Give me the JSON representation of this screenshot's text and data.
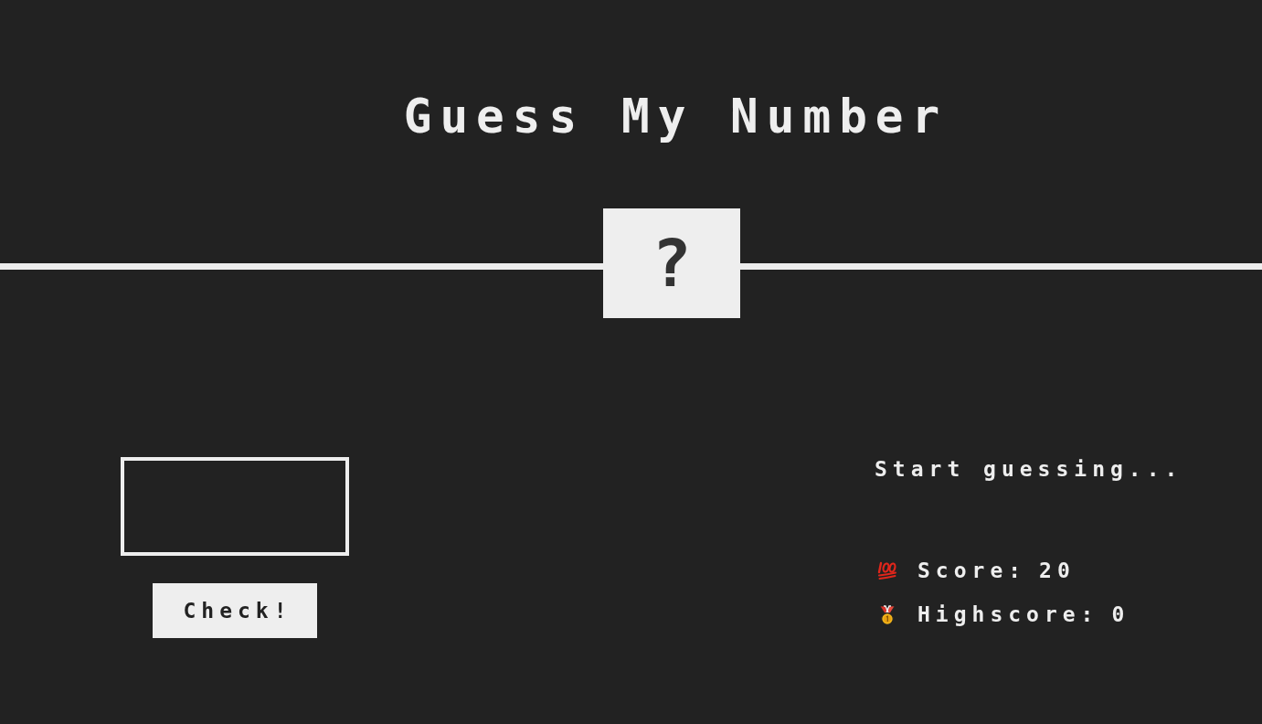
{
  "title": "Guess My Number",
  "secret_number": "?",
  "check_button": {
    "label": "Check!"
  },
  "message": "Start guessing...",
  "score": {
    "label": "Score:",
    "value": "20"
  },
  "highscore": {
    "label": "Highscore:",
    "value": "0"
  }
}
